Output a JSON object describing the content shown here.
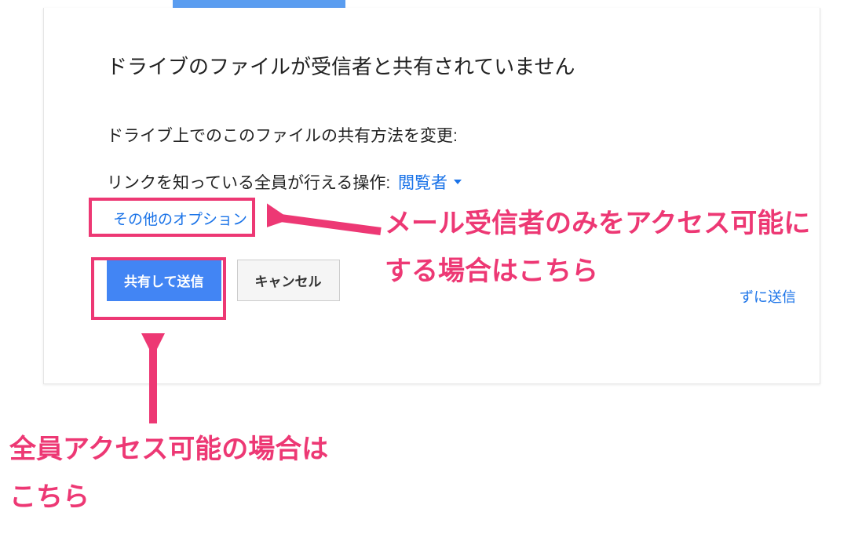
{
  "dialog": {
    "title": "ドライブのファイルが受信者と共有されていません",
    "subtitle": "ドライブ上でのこのファイルの共有方法を変更:",
    "link_label": "リンクを知っている全員が行える操作:",
    "dropdown_value": "閲覧者",
    "other_options": "その他のオプション",
    "share_send_button": "共有して送信",
    "cancel_button": "キャンセル",
    "send_without_share": "ずに送信"
  },
  "annotations": {
    "right": "メール受信者のみをアクセス可能にする場合はこちら",
    "bottom": "全員アクセス可能の場合はこちら"
  }
}
